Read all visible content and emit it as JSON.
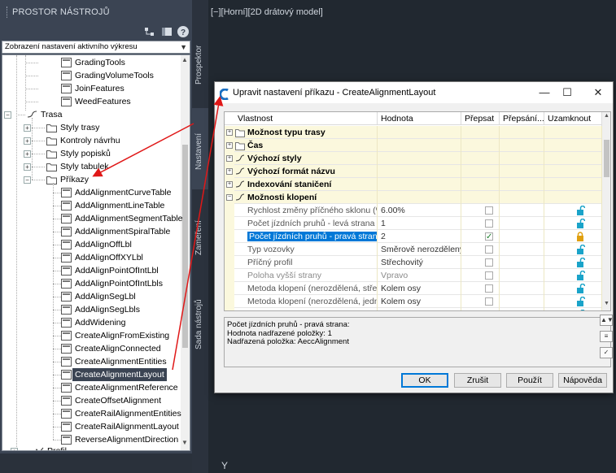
{
  "palette": {
    "title": "PROSTOR NÁSTROJŮ",
    "combo_value": "Zobrazení nastavení aktivního výkresu",
    "side_tabs": [
      "Prospektor",
      "Nastavení",
      "Zaměření",
      "Sada nástrojů"
    ],
    "tree_top": [
      {
        "label": "GradingTools",
        "icon": "command-icon"
      },
      {
        "label": "GradingVolumeTools",
        "icon": "command-icon"
      },
      {
        "label": "JoinFeatures",
        "icon": "command-icon"
      },
      {
        "label": "WeedFeatures",
        "icon": "command-icon"
      }
    ],
    "trasa": {
      "label": "Trasa"
    },
    "trasa_children": [
      {
        "label": "Styly trasy"
      },
      {
        "label": "Kontroly návrhu"
      },
      {
        "label": "Styly popisků"
      },
      {
        "label": "Styly tabulek"
      },
      {
        "label": "Příkazy"
      }
    ],
    "commands": [
      "AddAlignmentCurveTable",
      "AddAlignmentLineTable",
      "AddAlignmentSegmentTable",
      "AddAlignmentSpiralTable",
      "AddAlignOffLbl",
      "AddAlignOffXYLbl",
      "AddAlignPointOfIntLbl",
      "AddAlignPointOfIntLbls",
      "AddAlignSegLbl",
      "AddAlignSegLbls",
      "AddWidening",
      "CreateAlignFromExisting",
      "CreateAlignConnected",
      "CreateAlignmentEntities",
      "CreateAlignmentLayout",
      "CreateAlignmentReference",
      "CreateOffsetAlignment",
      "CreateRailAlignmentEntities",
      "CreateRailAlignmentLayout",
      "ReverseAlignmentDirection"
    ],
    "selected_command": "CreateAlignmentLayout",
    "profil_label": "Profil"
  },
  "model_space": {
    "view_label": "[−][Horní][2D drátový model]",
    "ucs_label": "Y"
  },
  "dialog": {
    "title": "Upravit nastavení příkazu - CreateAlignmentLayout",
    "columns": [
      "Vlastnost",
      "Hodnota",
      "Přepsat",
      "Přepsání...",
      "Uzamknout"
    ],
    "categories": [
      {
        "label": "Možnost typu trasy",
        "expander": "+"
      },
      {
        "label": "Čas",
        "expander": "+"
      },
      {
        "label": "Výchozí styly",
        "expander": "+"
      },
      {
        "label": "Výchozí formát názvu",
        "expander": "+"
      },
      {
        "label": "Indexování staničení",
        "expander": "+"
      },
      {
        "label": "Možnosti klopení",
        "expander": "−"
      }
    ],
    "rows": [
      {
        "prop": "Rychlost změny příčného sklonu (%)",
        "value": "6.00%",
        "checked": false,
        "lock": "unlocked"
      },
      {
        "prop": "Počet jízdních pruhů - levá strana",
        "value": "1",
        "checked": false,
        "lock": "unlocked"
      },
      {
        "prop": "Počet jízdních pruhů - pravá strana",
        "value": "2",
        "checked": true,
        "lock": "locked"
      },
      {
        "prop": "Typ vozovky",
        "value": "Směrově nerozdělený",
        "checked": false,
        "lock": "unlocked"
      },
      {
        "prop": "Příčný profil",
        "value": "Střechovitý",
        "checked": false,
        "lock": "unlocked"
      },
      {
        "prop": "Poloha vyšší strany",
        "value": "Vpravo",
        "checked": false,
        "lock": "unlocked"
      },
      {
        "prop": "Metoda klopení (nerozdělená, střec...",
        "value": "Kolem osy",
        "checked": false,
        "lock": "unlocked"
      },
      {
        "prop": "Metoda klopení (nerozdělená, jedn...",
        "value": "Kolem osy",
        "checked": false,
        "lock": "unlocked"
      },
      {
        "prop": "Metoda klopení (rozdělená, střech...",
        "value": "Kolem os...",
        "checked": false,
        "lock": "unlocked"
      }
    ],
    "description": [
      "Počet jízdních pruhů - pravá strana:",
      "Hodnota nadřazené položky: 1",
      "Nadřazená položka: AeccAlignment"
    ],
    "buttons": {
      "ok": "OK",
      "cancel": "Zrušit",
      "apply": "Použít",
      "help": "Nápověda"
    }
  },
  "colors": {
    "palette_bg": "#3b4453",
    "model_bg": "#212830",
    "selection": "#0078d7",
    "category_bg": "#fbf8dd",
    "annotation_arrow": "#e01818",
    "lock_color": "#1aa3c9",
    "locked_color": "#e0a010"
  }
}
